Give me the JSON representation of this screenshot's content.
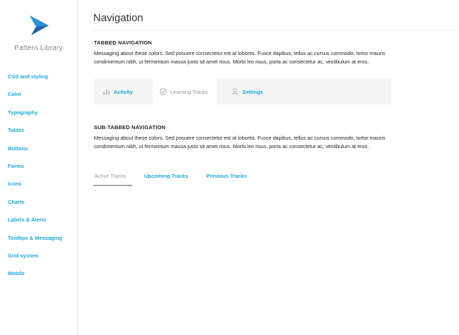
{
  "sidebar": {
    "library_title": "Pattern Library",
    "items": [
      {
        "label": "CSS and styling"
      },
      {
        "label": "Color"
      },
      {
        "label": "Typography"
      },
      {
        "label": "Tables"
      },
      {
        "label": "Buttons"
      },
      {
        "label": "Forms"
      },
      {
        "label": "Icons"
      },
      {
        "label": "Charts"
      },
      {
        "label": "Labels & Alerts"
      },
      {
        "label": "Tooltips & Messaging"
      },
      {
        "label": "Grid system"
      },
      {
        "label": "Mobile"
      }
    ]
  },
  "page": {
    "title": "Navigation"
  },
  "tabbed": {
    "heading": "TABBED NAVIGATION",
    "description": "Messaging about these colors. Sed posuere consectetur est at lobortis. Fusce dapibus, tellus ac cursus commodo, tortor mauris condimentum nibh, ut fermentum massa justo sit amet risus. Morbi leo risus, porta ac consectetur ac, vestibulum at eros.",
    "tabs": [
      {
        "label": "Activity",
        "icon": "bar-chart-icon"
      },
      {
        "label": "Learning Tracks",
        "icon": "check-circle-icon",
        "active": true
      },
      {
        "label": "Settings",
        "icon": "user-icon"
      }
    ]
  },
  "subtabbed": {
    "heading": "SUB-TABBED NAVIGATION",
    "description": "Messaging about these colors. Sed posuere consectetur est at lobortis. Fusce dapibus, tellus ac cursus commodo, tortor mauris condimentum nibh, ut fermentum massa justo sit amet risus. Morbi leo risus, porta ac consectetur ac, vestibulum at eros.",
    "tabs": [
      {
        "label": "Active Tracks",
        "active": true
      },
      {
        "label": "Upcoming Tracks"
      },
      {
        "label": "Previous Tracks"
      }
    ]
  },
  "colors": {
    "accent": "#1ba8d8",
    "logo_dark": "#1f5fa6",
    "logo_light": "#2b8fd6",
    "muted": "#9a9a9a"
  }
}
